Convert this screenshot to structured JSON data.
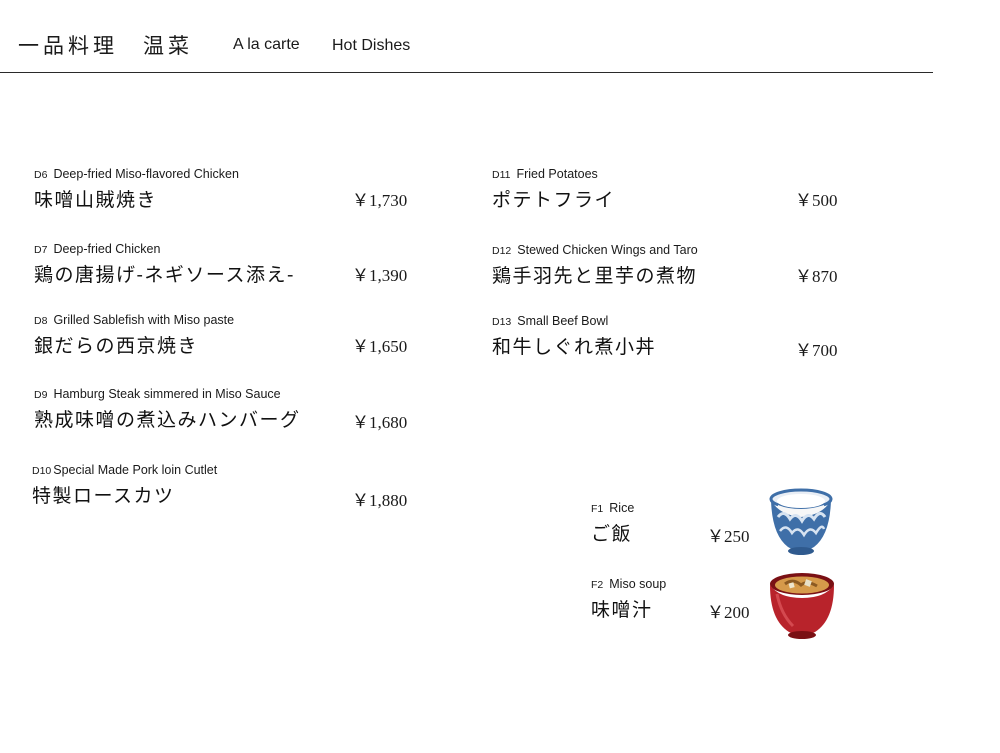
{
  "header": {
    "title_jp": "一品料理　温菜",
    "subtitle_fr": "A la carte",
    "subtitle_en": "Hot Dishes"
  },
  "left_items": [
    {
      "code": "D6",
      "en": "Deep-fried Miso-flavored Chicken",
      "jp": "味噌山賊焼き",
      "price": "￥1,730"
    },
    {
      "code": "D7",
      "en": "Deep-fried Chicken",
      "jp": "鶏の唐揚げ-ネギソース添え-",
      "price": "￥1,390"
    },
    {
      "code": "D8",
      "en": "Grilled Sablefish with Miso paste",
      "jp": "銀だらの西京焼き",
      "price": "￥1,650"
    },
    {
      "code": "D9",
      "en": "Hamburg Steak simmered in Miso Sauce",
      "jp": "熟成味噌の煮込みハンバーグ",
      "price": "￥1,680"
    },
    {
      "code": "D10",
      "en": "Special Made Pork loin Cutlet",
      "jp": "特製ロースカツ",
      "price": "￥1,880"
    }
  ],
  "right_items": [
    {
      "code": "D11",
      "en": "Fried Potatoes",
      "jp": "ポテトフライ",
      "price": "￥500"
    },
    {
      "code": "D12",
      "en": "Stewed Chicken Wings and Taro",
      "jp": "鶏手羽先と里芋の煮物",
      "price": "￥870"
    },
    {
      "code": "D13",
      "en": "Small Beef Bowl",
      "jp": "和牛しぐれ煮小丼",
      "price": "￥700"
    }
  ],
  "side_items": [
    {
      "code": "F1",
      "en": "Rice",
      "jp": "ご飯",
      "price": "￥250",
      "icon": "rice-bowl-icon"
    },
    {
      "code": "F2",
      "en": "Miso soup",
      "jp": "味噌汁",
      "price": "￥200",
      "icon": "miso-soup-bowl-icon"
    }
  ],
  "colors": {
    "text": "#1a1a1a",
    "rule": "#2a2a2a",
    "bowl_blue": "#3f6fa8",
    "bowl_red": "#b8232b"
  }
}
